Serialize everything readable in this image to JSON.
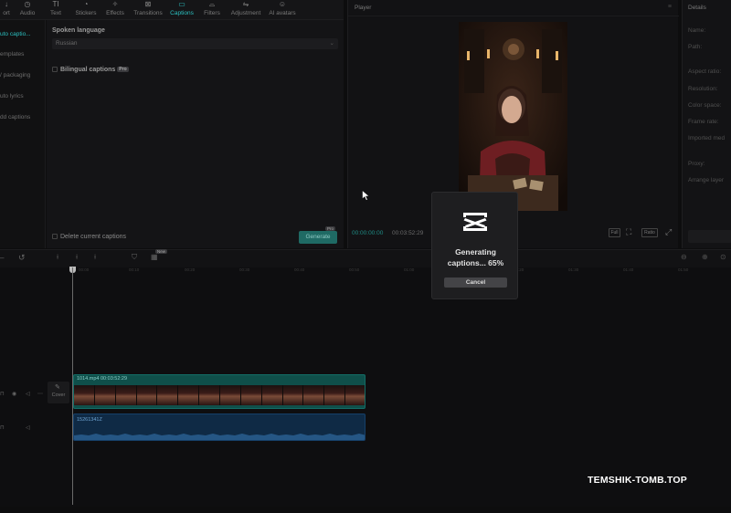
{
  "toolbar": {
    "tools": [
      {
        "label": "ort",
        "icon": "import-icon"
      },
      {
        "label": "Audio",
        "icon": "audio-icon"
      },
      {
        "label": "Text",
        "icon": "text-icon"
      },
      {
        "label": "Stickers",
        "icon": "sticker-icon"
      },
      {
        "label": "Effects",
        "icon": "effects-icon"
      },
      {
        "label": "Transitions",
        "icon": "transitions-icon"
      },
      {
        "label": "Captions",
        "icon": "captions-icon",
        "active": true
      },
      {
        "label": "Filters",
        "icon": "filters-icon"
      },
      {
        "label": "Adjustment",
        "icon": "adjustment-icon"
      },
      {
        "label": "AI avatars",
        "icon": "avatar-icon"
      }
    ]
  },
  "sidebar": {
    "items": [
      {
        "label": "uto captio...",
        "active": true
      },
      {
        "label": "emplates"
      },
      {
        "label": "/ packaging"
      },
      {
        "label": "uto lyrics"
      },
      {
        "label": "dd captions"
      }
    ]
  },
  "captions_panel": {
    "spoken_language_label": "Spoken language",
    "language_value": "Russian",
    "bilingual_label": "Bilingual captions",
    "pro_badge": "Pro",
    "delete_label": "Delete current captions",
    "generate_label": "Generate",
    "new_badge": "Pro"
  },
  "player": {
    "title": "Player",
    "time_current": "00:00:00:00",
    "time_total": "00:03:52:29",
    "ratio_label": "Full",
    "ratio2_label": "Ratio"
  },
  "details": {
    "title": "Details",
    "fields": [
      "Name:",
      "Path:",
      "Aspect ratio:",
      "Resolution:",
      "Color space:",
      "Frame rate:",
      "Imported med",
      "Proxy:",
      "Arrange layer"
    ]
  },
  "timeline": {
    "new_badge": "New",
    "cover_label": "Cover",
    "video_clip_label": "1014.mp4  00:03:52:29",
    "audio_clip_label": "15261341Z",
    "ticks": [
      "00:00",
      "00:10",
      "00:20",
      "00:30",
      "00:40",
      "00:50",
      "01:00",
      "01:10",
      "01:20",
      "01:30",
      "01:40",
      "01:50"
    ]
  },
  "dialog": {
    "line1": "Generating",
    "line2": "captions... 65%",
    "progress_percent": 65,
    "cancel_label": "Cancel"
  },
  "watermark": "TEMSHIK-TOMB.TOP",
  "colors": {
    "accent": "#2bc0c0",
    "video_clip": "#0f4f4a",
    "audio_clip": "#0f2a45",
    "dialog_bg": "#1e1e20"
  }
}
